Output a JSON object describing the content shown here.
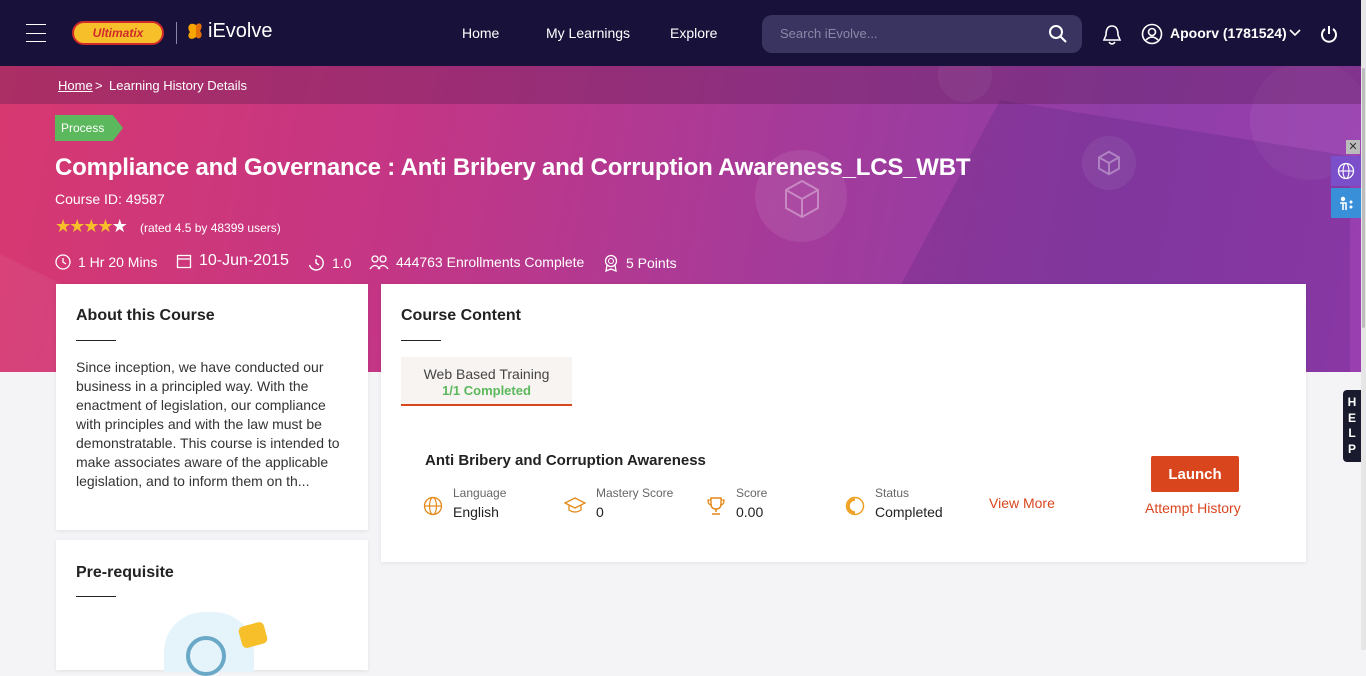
{
  "header": {
    "brand_primary": "Ultimatix",
    "brand_secondary": "iEvolve",
    "nav": [
      "Home",
      "My Learnings",
      "Explore"
    ],
    "search_placeholder": "Search iEvolve...",
    "user_name": "Apoorv (1781524)",
    "icons": [
      "menu-icon",
      "search-icon",
      "bell-icon",
      "user-icon",
      "chevron-down-icon",
      "power-icon"
    ]
  },
  "breadcrumb": {
    "home": "Home",
    "separator": ">",
    "current": "Learning History Details"
  },
  "course": {
    "tag": "Process",
    "title": "Compliance and Governance : Anti Bribery and Corruption Awareness_LCS_WBT",
    "course_id": "Course ID: 49587",
    "rating_stars": 4.5,
    "rating_text": "(rated 4.5 by 48399 users)",
    "duration": "1 Hr 20 Mins",
    "date": "10-Jun-2015",
    "version": "1.0",
    "enrollments": "444763 Enrollments Complete",
    "points": "5 Points"
  },
  "about": {
    "heading": "About this Course",
    "text": "Since inception, we have conducted our business in a principled way. With the enactment of legislation, our compliance with principles and with the law must be demonstratable. This course is intended to make associates aware of the applicable legislation, and to inform them on th..."
  },
  "prereq": {
    "heading": "Pre-requisite"
  },
  "content": {
    "heading": "Course Content",
    "tab": {
      "label": "Web Based Training",
      "status": "1/1 Completed"
    },
    "module": {
      "title": "Anti Bribery and Corruption Awareness",
      "fields": [
        {
          "label": "Language",
          "value": "English",
          "icon": "globe-icon"
        },
        {
          "label": "Mastery Score",
          "value": "0",
          "icon": "graduation-cap-icon"
        },
        {
          "label": "Score",
          "value": "0.00",
          "icon": "trophy-icon"
        },
        {
          "label": "Status",
          "value": "Completed",
          "icon": "status-ring-icon"
        }
      ],
      "view_more": "View More",
      "launch": "Launch",
      "attempt_history": "Attempt History"
    }
  },
  "help_letters": [
    "H",
    "E",
    "L",
    "P"
  ],
  "colors": {
    "accent": "#d9461e",
    "success": "#5cb85c",
    "topbar": "#18123a",
    "star": "#f7c02b"
  }
}
